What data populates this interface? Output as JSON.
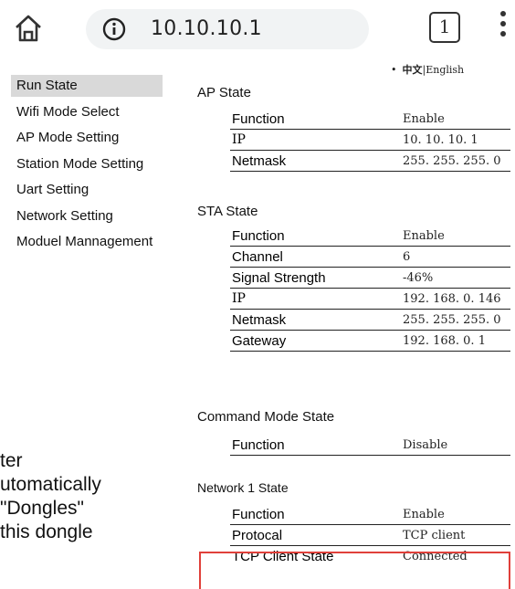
{
  "browser": {
    "url": "10.10.10.1",
    "tab_count": "1"
  },
  "language": {
    "chinese": "中文",
    "separator": "|",
    "english": "English"
  },
  "sidebar": {
    "items": [
      {
        "label": "Run State",
        "active": true
      },
      {
        "label": "Wifi Mode Select"
      },
      {
        "label": "AP Mode Setting"
      },
      {
        "label": "Station Mode Setting"
      },
      {
        "label": "Uart Setting"
      },
      {
        "label": "Network Setting"
      },
      {
        "label": "Moduel Mannagement"
      }
    ]
  },
  "ap_state": {
    "title": "AP State",
    "rows": [
      {
        "key": "Function",
        "value": "Enable"
      },
      {
        "key": "IP",
        "value": "10. 10. 10. 1"
      },
      {
        "key": "Netmask",
        "value": "255. 255. 255. 0"
      }
    ]
  },
  "sta_state": {
    "title": "STA State",
    "rows": [
      {
        "key": "Function",
        "value": "Enable"
      },
      {
        "key": "Channel",
        "value": "6"
      },
      {
        "key": "Signal Strength",
        "value": "-46%"
      },
      {
        "key": "IP",
        "value": "192. 168. 0. 146"
      },
      {
        "key": "Netmask",
        "value": "255. 255. 255. 0"
      },
      {
        "key": "Gateway",
        "value": "192. 168. 0. 1"
      }
    ]
  },
  "command_mode_state": {
    "title": "Command Mode State",
    "rows": [
      {
        "key": "Function",
        "value": "Disable"
      }
    ]
  },
  "network1_state": {
    "title": "Network 1 State",
    "rows": [
      {
        "key": "Function",
        "value": "Enable"
      },
      {
        "key": "Protocal",
        "value": "TCP client"
      },
      {
        "key": "TCP Client State",
        "value": "Connected"
      }
    ]
  },
  "background_text": {
    "lines": [
      "ter",
      "utomatically",
      "\"Dongles\"",
      " this dongle"
    ]
  },
  "colors": {
    "highlight_border": "#e0403a",
    "active_nav_bg": "#d9d9d9",
    "url_bar_bg": "#f1f3f4"
  }
}
